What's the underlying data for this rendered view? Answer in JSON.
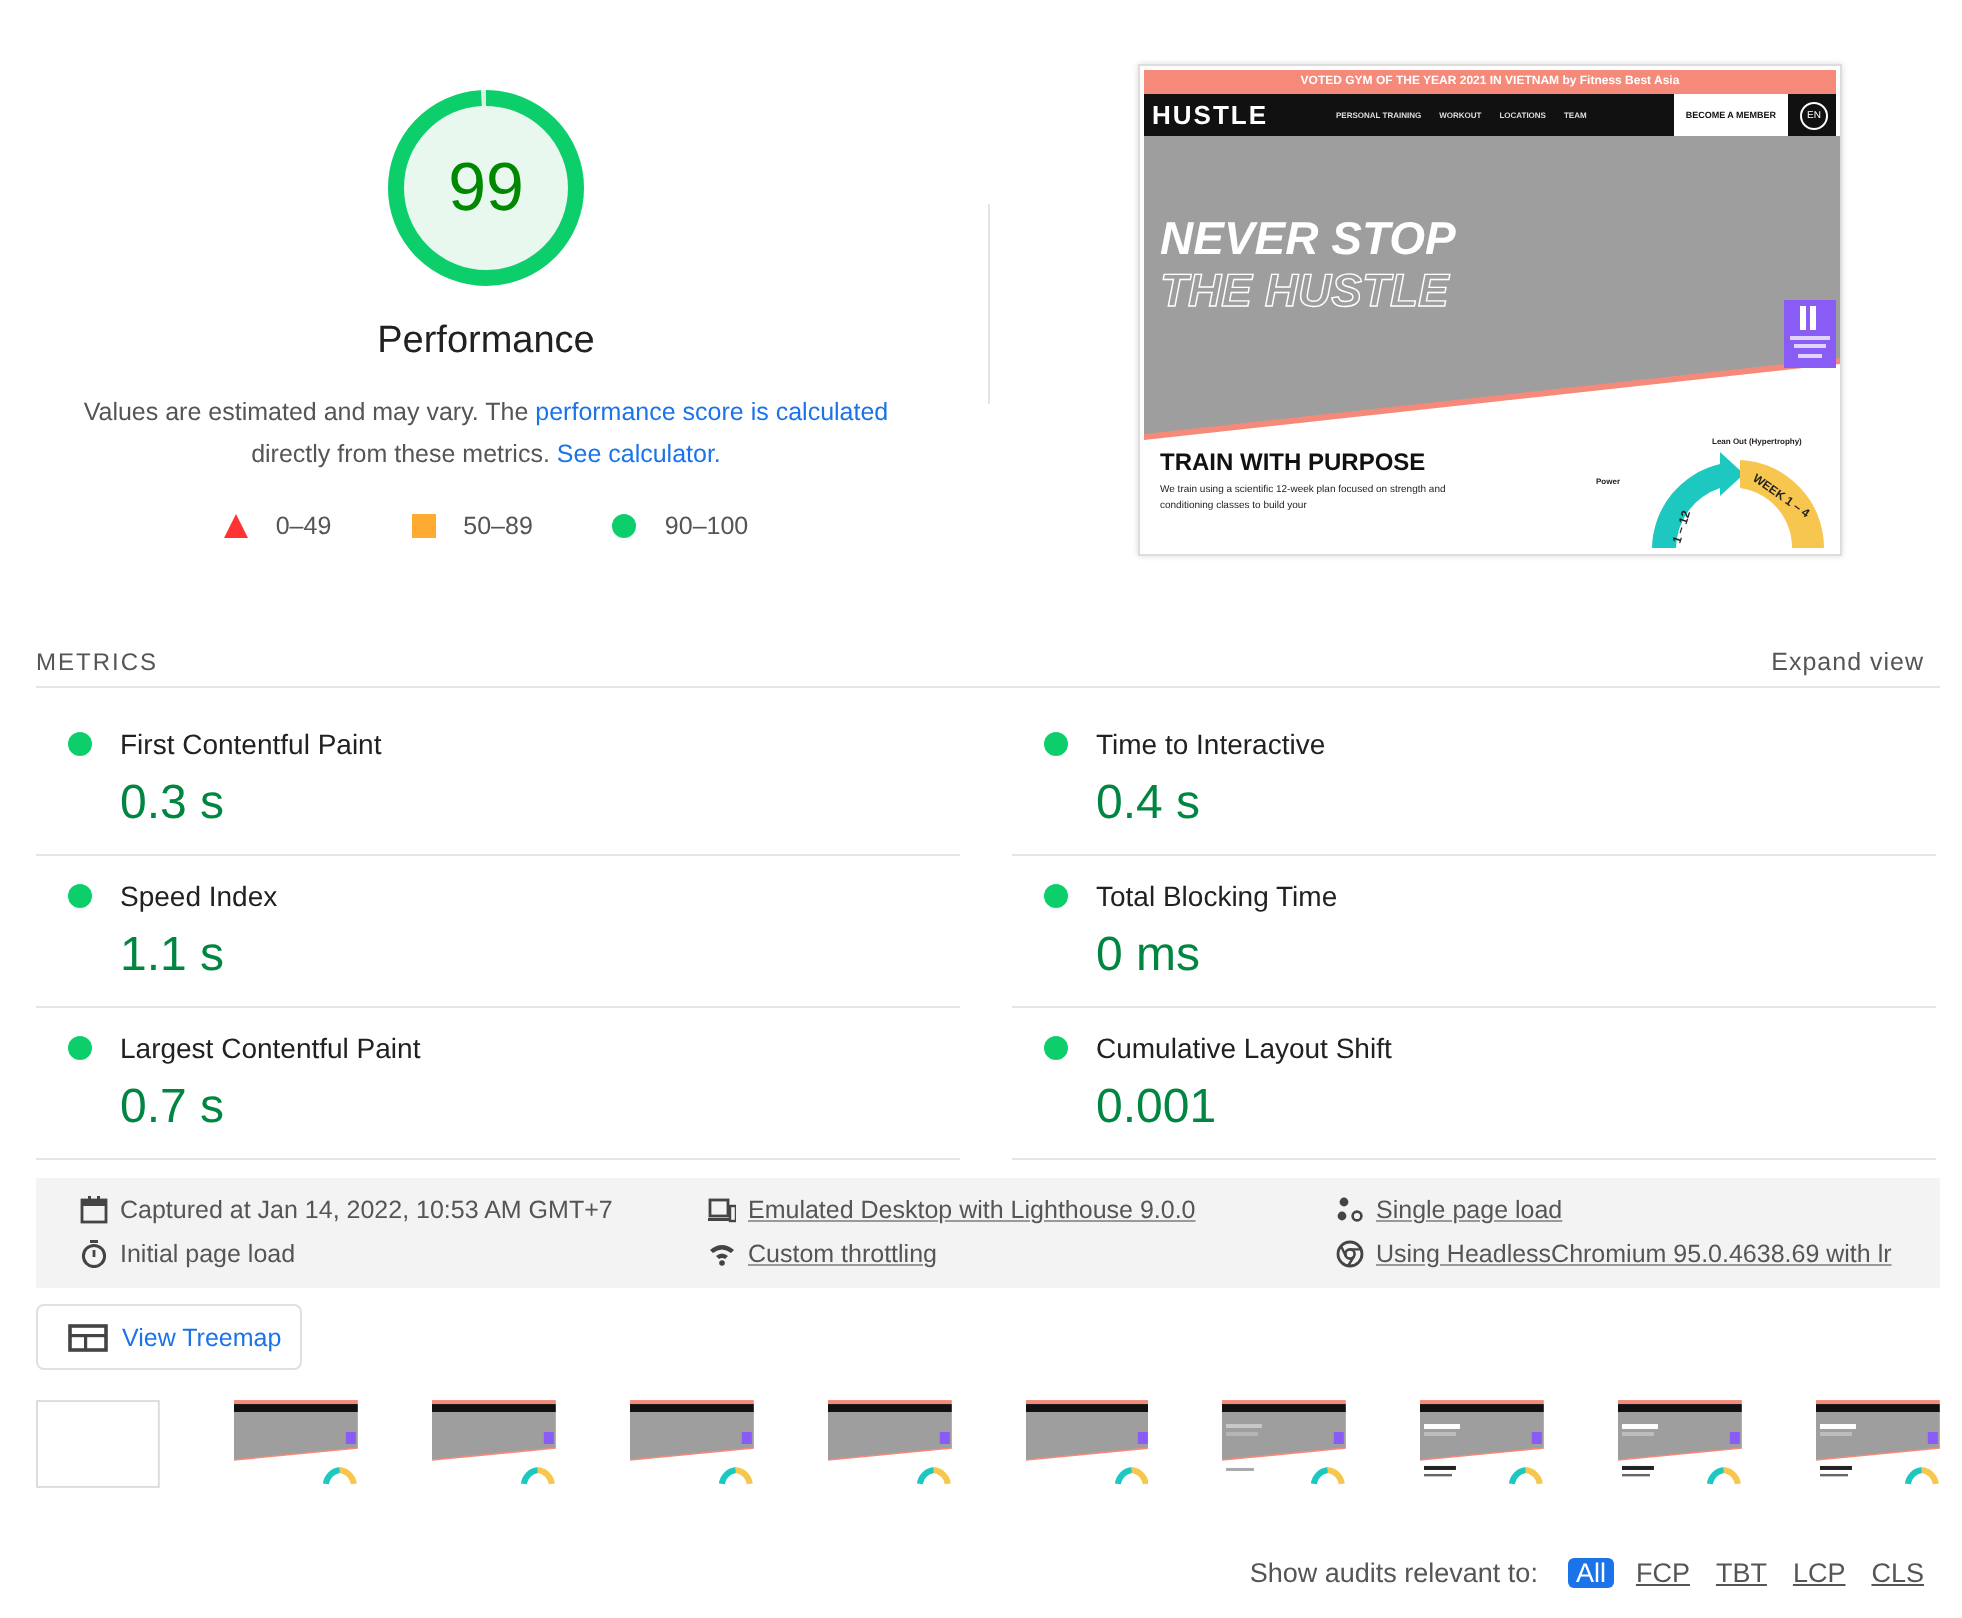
{
  "score": {
    "value": "99",
    "level": 0.99,
    "title": "Performance"
  },
  "description": {
    "text": "Values are estimated and may vary. The ",
    "link1": "performance score is calculated",
    "middle": " directly from these metrics. ",
    "link2": "See calculator."
  },
  "legend": [
    {
      "kind": "triangle",
      "label": "0–49"
    },
    {
      "kind": "square",
      "label": "50–89"
    },
    {
      "kind": "circle",
      "label": "90–100"
    }
  ],
  "screenshot": {
    "banner": "VOTED GYM OF THE YEAR 2021 IN VIETNAM by Fitness Best Asia",
    "logo": "HUSTLE",
    "nav": [
      "PERSONAL TRAINING",
      "WORKOUT",
      "LOCATIONS",
      "TEAM"
    ],
    "cta": "BECOME A MEMBER",
    "language": "EN",
    "headline": "NEVER STOP",
    "outline": "THE HUSTLE",
    "heading": "TRAIN WITH PURPOSE",
    "body": "We train using a scientific 12-week plan focused on strength and conditioning classes to build your",
    "chart_labels": [
      "Power",
      "Lean Out (Hypertrophy)"
    ],
    "arc_labels": [
      "1 – 12",
      "WEEK 1 – 4"
    ]
  },
  "metrics_title": "METRICS",
  "expand": "Expand view",
  "metrics": [
    {
      "label": "First Contentful Paint",
      "value": "0.3 s",
      "color": "#0cce6b"
    },
    {
      "label": "Time to Interactive",
      "value": "0.4 s",
      "color": "#0cce6b"
    },
    {
      "label": "Speed Index",
      "value": "1.1 s",
      "color": "#0cce6b"
    },
    {
      "label": "Total Blocking Time",
      "value": "0 ms",
      "color": "#0cce6b"
    },
    {
      "label": "Largest Contentful Paint",
      "value": "0.7 s",
      "color": "#0cce6b"
    },
    {
      "label": "Cumulative Layout Shift",
      "value": "0.001",
      "color": "#0cce6b"
    }
  ],
  "info": [
    {
      "kind": "calendar",
      "text": "Captured at Jan 14, 2022, 10:53 AM GMT+7",
      "linked": false
    },
    {
      "kind": "devices",
      "text": "Emulated Desktop with Lighthouse 9.0.0",
      "linked": true
    },
    {
      "kind": "dots",
      "text": "Single page load",
      "linked": true
    },
    {
      "kind": "timer",
      "text": "Initial page load",
      "linked": false
    },
    {
      "kind": "wifi",
      "text": "Custom throttling",
      "linked": true
    },
    {
      "kind": "chrome",
      "text": "Using HeadlessChromium 95.0.4638.69 with lr",
      "linked": true
    }
  ],
  "treemap_button": "View Treemap",
  "filmstrip": [
    {
      "kind": "blank"
    },
    {
      "kind": "hero"
    },
    {
      "kind": "hero"
    },
    {
      "kind": "hero"
    },
    {
      "kind": "hero"
    },
    {
      "kind": "hero"
    },
    {
      "kind": "faint"
    },
    {
      "kind": "full"
    },
    {
      "kind": "full"
    },
    {
      "kind": "full"
    }
  ],
  "filter": {
    "label": "Show audits relevant to:",
    "options": [
      {
        "label": "All",
        "selected": true
      },
      {
        "label": "FCP",
        "selected": false
      },
      {
        "label": "TBT",
        "selected": false
      },
      {
        "label": "LCP",
        "selected": false
      },
      {
        "label": "CLS",
        "selected": false
      }
    ]
  }
}
